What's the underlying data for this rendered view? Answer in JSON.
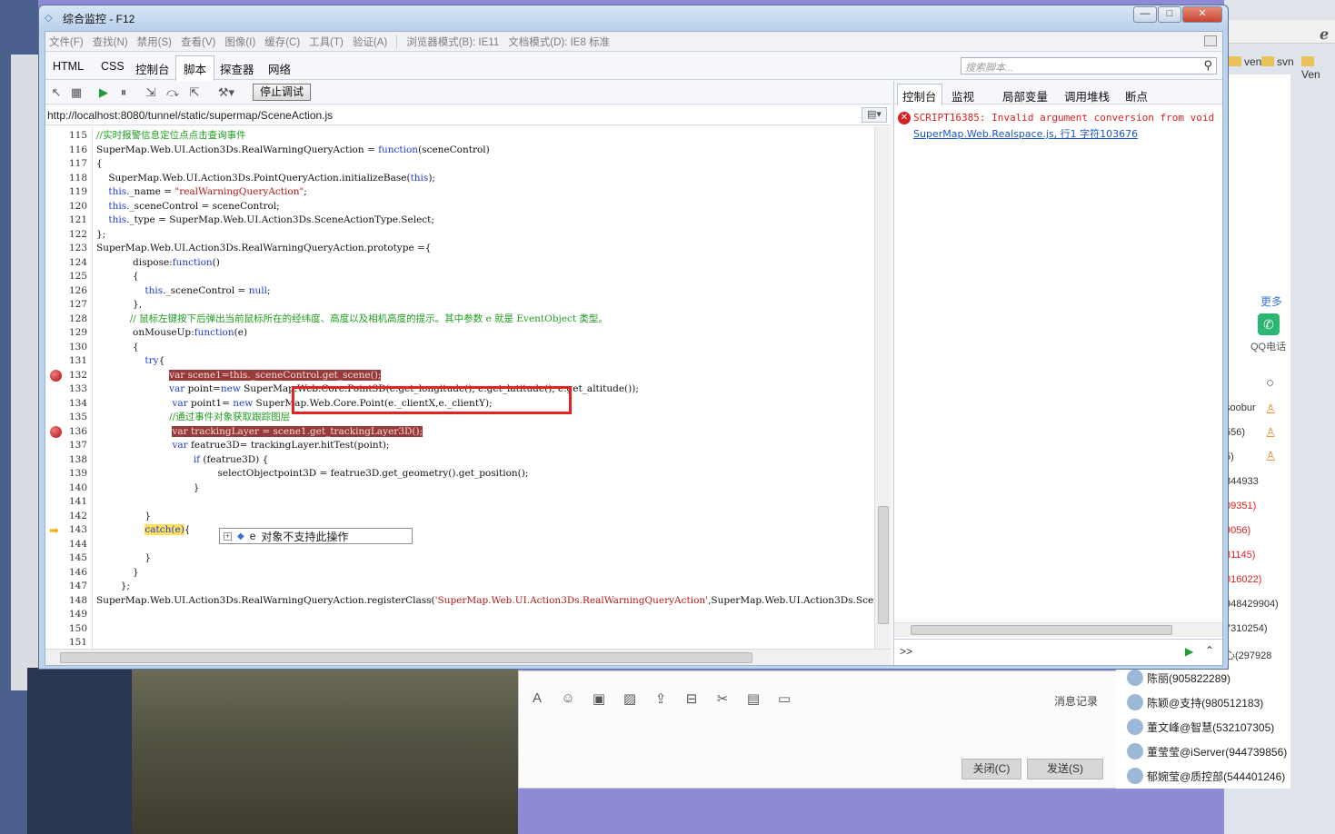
{
  "window": {
    "title": "综合监控 - F12",
    "minimize_label": "—",
    "maximize_label": "□",
    "close_label": "✕"
  },
  "menu": [
    "文件(F)",
    "查找(N)",
    "禁用(S)",
    "查看(V)",
    "图像(I)",
    "缓存(C)",
    "工具(T)",
    "验证(A)",
    "浏览器模式(B): IE11",
    "文档模式(D): IE8 标准"
  ],
  "tabs": [
    "HTML",
    "CSS",
    "控制台",
    "脚本",
    "探查器",
    "网络"
  ],
  "active_tab": "脚本",
  "search": {
    "placeholder": "搜索脚本..."
  },
  "toolbar": {
    "stop_debug": "停止调试"
  },
  "url": "http://localhost:8080/tunnel/static/supermap/SceneAction.js",
  "code": {
    "first_line": 115,
    "breakpoint_lines": [
      132,
      136
    ],
    "current_line": 143,
    "lines": [
      "//实时报警信息定位点点击查询事件",
      "SuperMap.Web.UI.Action3Ds.RealWarningQueryAction = function(sceneControl)",
      "{",
      "    SuperMap.Web.UI.Action3Ds.PointQueryAction.initializeBase(this);",
      "    this._name = \"realWarningQueryAction\";",
      "    this._sceneControl = sceneControl;",
      "    this._type = SuperMap.Web.UI.Action3Ds.SceneActionType.Select;",
      "};",
      "SuperMap.Web.UI.Action3Ds.RealWarningQueryAction.prototype ={",
      "            dispose:function()",
      "            {",
      "                this._sceneControl = null;",
      "            },",
      "           // 鼠标左键按下后弹出当前鼠标所在的经纬度、高度以及相机高度的提示。其中参数 e 就是 EventObject 类型。",
      "            onMouseUp:function(e)",
      "            {",
      "                try{",
      "                        var scene1=this._sceneControl.get_scene();",
      "                        var point=new SuperMap.Web.Core.Point3D(e.get_longitude(), e.get_latitude(), e.get_altitude());",
      "                         var point1= new SuperMap.Web.Core.Point(e._clientX,e._clientY);",
      "                        //通过事件对象获取跟踪图层",
      "                         var trackingLayer = scene1.get_trackingLayer3D();",
      "                         var featrue3D= trackingLayer.hitTest(point);",
      "                                if (featrue3D) {",
      "                                        selectObjectpoint3D = featrue3D.get_geometry().get_position();",
      "                                }",
      "",
      "                }",
      "                catch(e){",
      "",
      "                }",
      "            }",
      "        };",
      "SuperMap.Web.UI.Action3Ds.RealWarningQueryAction.registerClass('SuperMap.Web.UI.Action3Ds.RealWarningQueryAction',SuperMap.Web.UI.Action3Ds.SceneAc",
      "",
      "",
      ""
    ]
  },
  "tooltip": {
    "var_name": "e",
    "value": "对象不支持此操作"
  },
  "right_panel": {
    "tabs": [
      "控制台",
      "监视",
      "局部变量",
      "调用堆栈",
      "断点"
    ],
    "active_tab": "控制台",
    "error_message": "SCRIPT16385: Invalid argument conversion from void",
    "error_link": "SuperMap.Web.Realspace.js, 行1 字符103676",
    "prompt": ">>"
  },
  "background": {
    "folders": [
      "ven",
      "svn",
      "Ven"
    ],
    "qq": {
      "more_label": "更多",
      "phone_label": "QQ电话",
      "history_label": "消息记录",
      "close_button": "关闭(C)",
      "send_button": "发送(S)",
      "side_numbers": [
        {
          "text": "soobur",
          "color": "#333333"
        },
        {
          "text": "556)",
          "color": "#333333"
        },
        {
          "text": "5)",
          "color": "#333333"
        },
        {
          "text": "844933",
          "color": "#333333"
        },
        {
          "text": "09351)",
          "color": "#e02020"
        },
        {
          "text": "9056)",
          "color": "#e02020"
        },
        {
          "text": "31145)",
          "color": "#e02020"
        },
        {
          "text": "016022)",
          "color": "#e02020"
        },
        {
          "text": "948429904)",
          "color": "#333333"
        },
        {
          "text": "7310254)",
          "color": "#333333"
        },
        {
          "text": "心(297928",
          "color": "#333333"
        }
      ],
      "members": [
        "陈丽(905822289)",
        "陈颖@支持(980512183)",
        "董文峰@智慧(532107305)",
        "董莹莹@iServer(944739856)",
        "郁婉莹@质控部(544401246)"
      ]
    }
  },
  "colors": {
    "breakpoint_highlight": "#983a3a",
    "current_line_highlight": "#ffe15c",
    "error_text": "#e11d1d",
    "annotation_box": "#e62121"
  }
}
